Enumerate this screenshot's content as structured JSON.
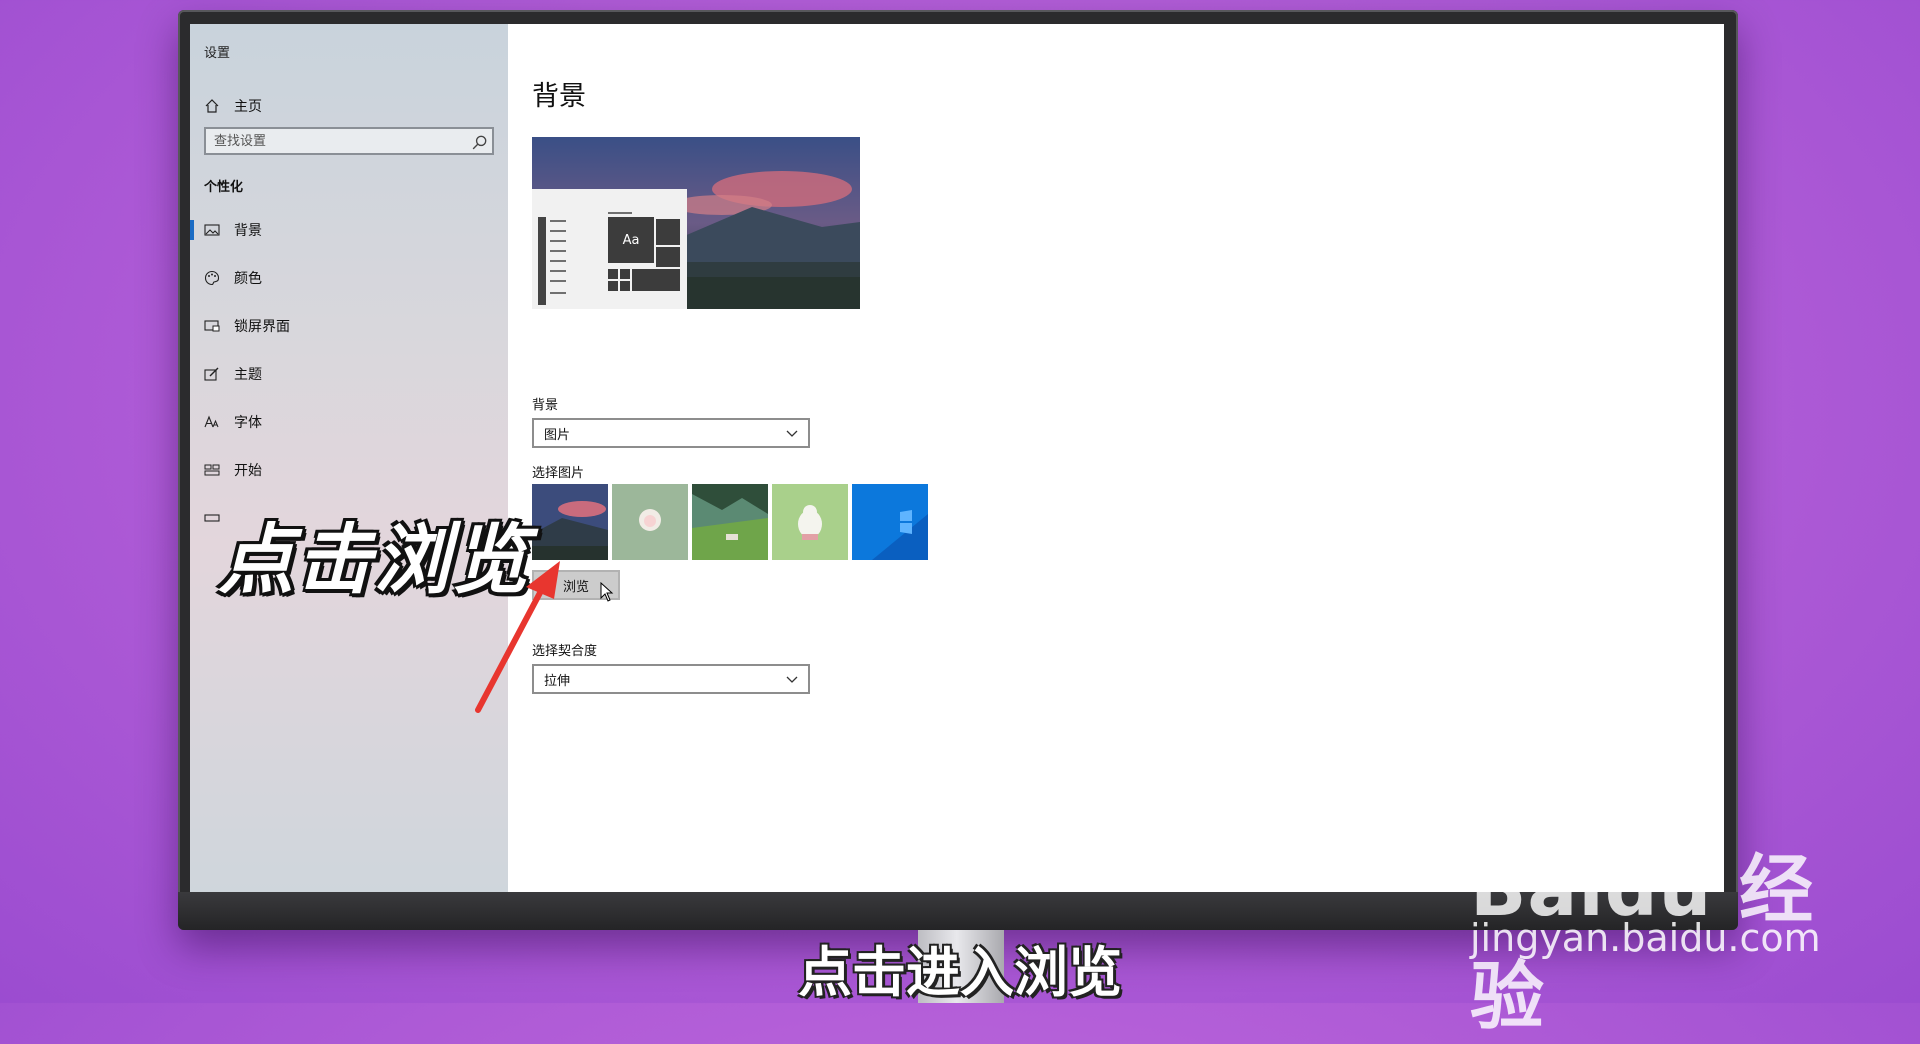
{
  "window": {
    "title": "设置"
  },
  "sidebar": {
    "home_label": "主页",
    "search_placeholder": "查找设置",
    "section_title": "个性化",
    "items": [
      {
        "label": "背景",
        "icon": "picture-icon",
        "active": true
      },
      {
        "label": "颜色",
        "icon": "palette-icon",
        "active": false
      },
      {
        "label": "锁屏界面",
        "icon": "lock-screen-icon",
        "active": false
      },
      {
        "label": "主题",
        "icon": "theme-brush-icon",
        "active": false
      },
      {
        "label": "字体",
        "icon": "font-icon",
        "active": false
      },
      {
        "label": "开始",
        "icon": "start-icon",
        "active": false
      },
      {
        "label": "",
        "icon": "taskbar-icon",
        "active": false
      }
    ]
  },
  "main": {
    "title": "背景",
    "preview_sample_text": "Aa",
    "background_label": "背景",
    "background_value": "图片",
    "choose_picture_label": "选择图片",
    "thumbnails": [
      "landscape-dusk",
      "sheep-green",
      "valley-meadow",
      "chick-green",
      "windows-blue"
    ],
    "browse_label": "浏览",
    "fit_label": "选择契合度",
    "fit_value": "拉伸"
  },
  "overlay": {
    "caption": "点击浏览",
    "subtitle": "点击进入浏览",
    "watermark_logo": "Baidu 经验",
    "watermark_url": "jingyan.baidu.com"
  },
  "colors": {
    "accent": "#1b6cc4",
    "arrow": "#e8362f",
    "background": "#b45fd8"
  }
}
